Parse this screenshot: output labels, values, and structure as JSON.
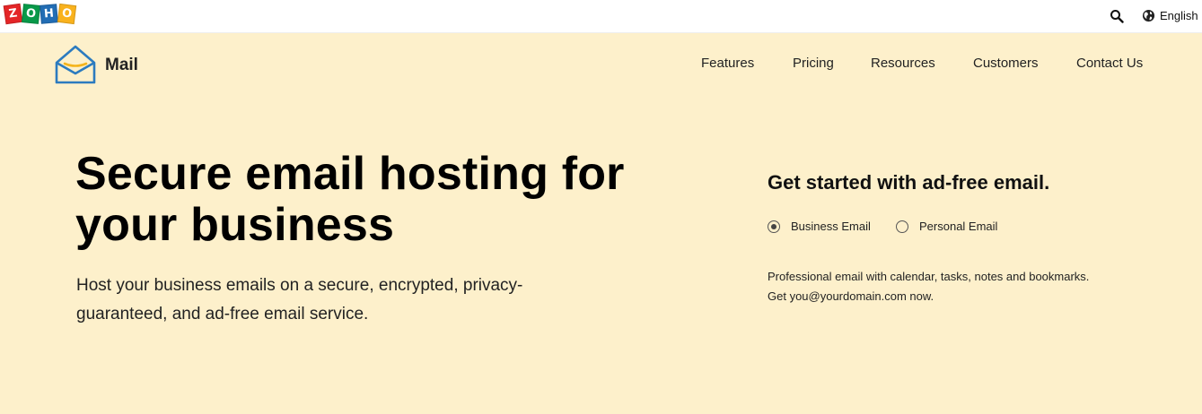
{
  "topbar": {
    "brand_letters": [
      "Z",
      "O",
      "H",
      "O"
    ],
    "brand_colors": [
      "#e42527",
      "#089949",
      "#226db4",
      "#f9b21d"
    ],
    "search_icon": "search-icon",
    "language_label": "English",
    "language_icon": "globe-icon"
  },
  "header": {
    "product_name": "Mail",
    "nav": [
      "Features",
      "Pricing",
      "Resources",
      "Customers",
      "Contact Us"
    ]
  },
  "hero": {
    "title_line1": "Secure email hosting for",
    "title_line2": "your business",
    "subtitle_line1": "Host your business emails on a secure, encrypted, privacy-",
    "subtitle_line2": "guaranteed, and ad-free email service."
  },
  "signup": {
    "title": "Get started with ad-free email.",
    "options": [
      {
        "label": "Business Email",
        "selected": true
      },
      {
        "label": "Personal Email",
        "selected": false
      }
    ],
    "desc_line1": "Professional email with calendar, tasks, notes and bookmarks.",
    "desc_line2": "Get you@yourdomain.com now."
  },
  "colors": {
    "background": "#fdf0cb",
    "topbar": "#ffffff",
    "logo_blue": "#2c7bbf",
    "logo_yellow": "#f5b41b"
  }
}
